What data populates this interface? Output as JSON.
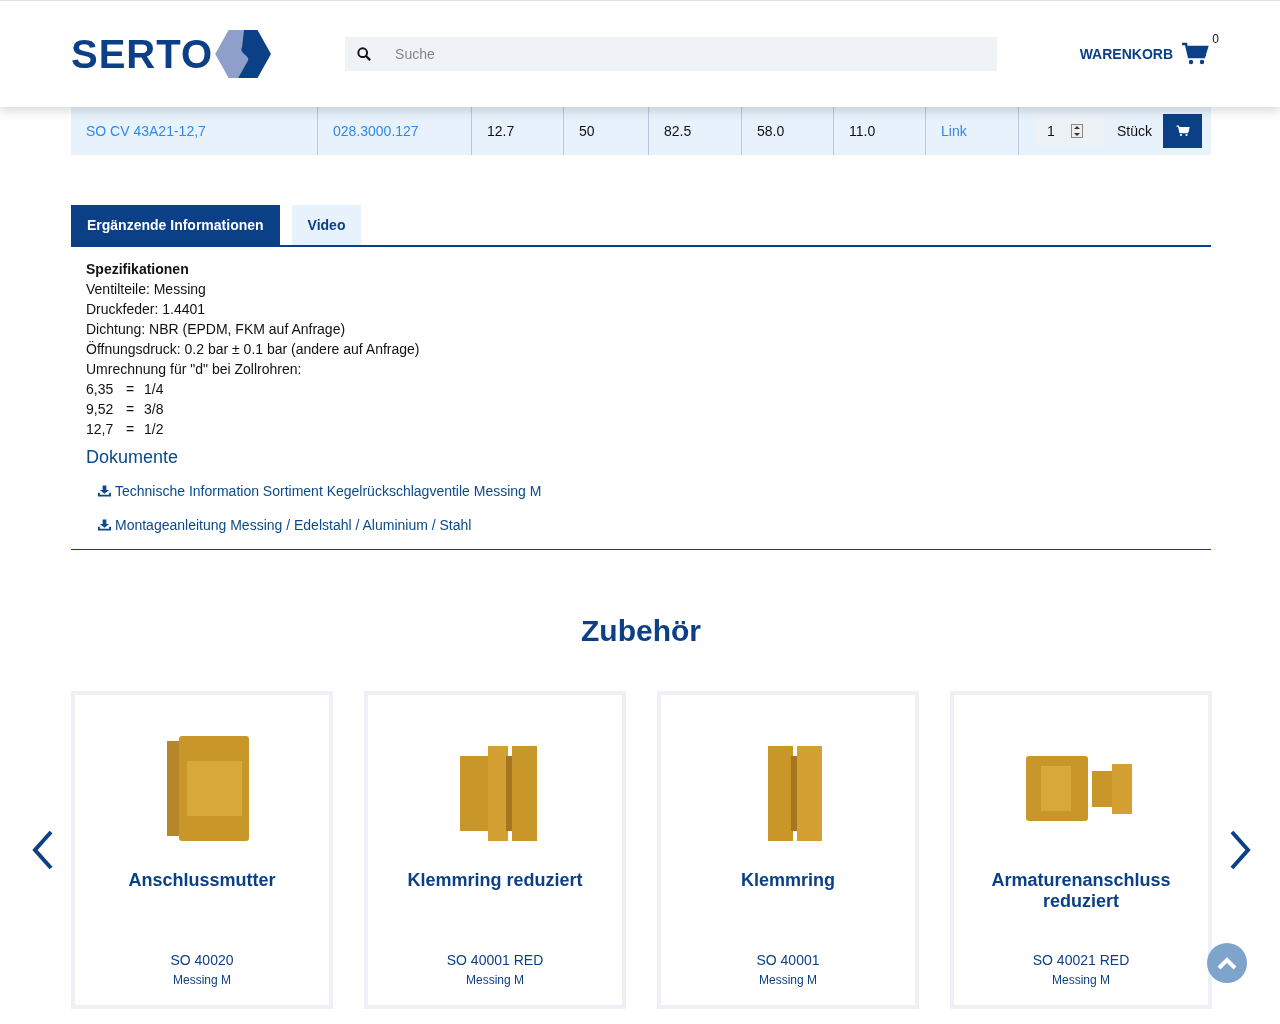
{
  "header": {
    "logo": "SERTO",
    "search": {
      "placeholder": "Suche"
    },
    "cart": {
      "label": "WARENKORB",
      "count": "0"
    }
  },
  "table_row": {
    "cells": [
      {
        "kind": "link",
        "text": "SO CV 43A21-12,7"
      },
      {
        "kind": "link",
        "text": "028.3000.127"
      },
      {
        "kind": "text",
        "text": "12.7"
      },
      {
        "kind": "text",
        "text": "50"
      },
      {
        "kind": "text",
        "text": "82.5"
      },
      {
        "kind": "text",
        "text": "58.0"
      },
      {
        "kind": "text",
        "text": "11.0"
      },
      {
        "kind": "link",
        "text": "Link"
      }
    ],
    "quantity": "1",
    "unit": "Stück"
  },
  "tabs": [
    {
      "label": "Ergänzende Informationen",
      "selected": true
    },
    {
      "label": "Video",
      "selected": false
    }
  ],
  "specs": {
    "title": "Spezifikationen",
    "lines": [
      "Ventilteile: Messing",
      "Druckfeder: 1.4401",
      "Dichtung: NBR (EPDM, FKM auf Anfrage)",
      "Öffnungsdruck: 0.2 bar ± 0.1 bar (andere auf Anfrage)",
      "Umrechnung für \"d\" bei Zollrohren:"
    ],
    "conversions": [
      {
        "mm": "6,35",
        "eq": "=",
        "inch": "1/4"
      },
      {
        "mm": "9,52",
        "eq": "=",
        "inch": "3/8"
      },
      {
        "mm": "12,7",
        "eq": "=",
        "inch": "1/2"
      }
    ]
  },
  "documents": {
    "title": "Dokumente",
    "items": [
      "Technische Information Sortiment Kegelrückschlagventile Messing M",
      "Montageanleitung Messing / Edelstahl / Aluminium / Stahl"
    ]
  },
  "accessories": {
    "title": "Zubehör",
    "cards": [
      {
        "kind": "nut",
        "name": "Anschlussmutter",
        "code": "SO 40020",
        "material": "Messing M"
      },
      {
        "kind": "ring-reduced",
        "name": "Klemmring reduziert",
        "code": "SO 40001 RED",
        "material": "Messing M"
      },
      {
        "kind": "ring",
        "name": "Klemmring",
        "code": "SO 40001",
        "material": "Messing M"
      },
      {
        "kind": "adapter",
        "name": "Armaturenanschluss reduziert",
        "code": "SO 40021 RED",
        "material": "Messing M"
      }
    ]
  }
}
